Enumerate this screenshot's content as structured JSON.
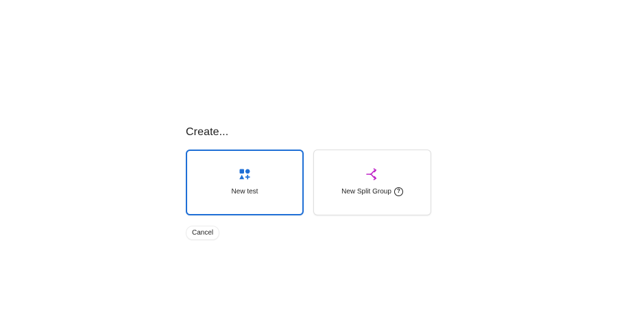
{
  "dialog": {
    "title": "Create...",
    "options": [
      {
        "label": "New test",
        "icon": "shapes-add-icon",
        "selected": true,
        "accent": "#1f6fd6"
      },
      {
        "label": "New Split Group",
        "icon": "split-arrows-icon",
        "selected": false,
        "accent": "#c026c8",
        "help": "?"
      }
    ],
    "cancel_label": "Cancel"
  }
}
